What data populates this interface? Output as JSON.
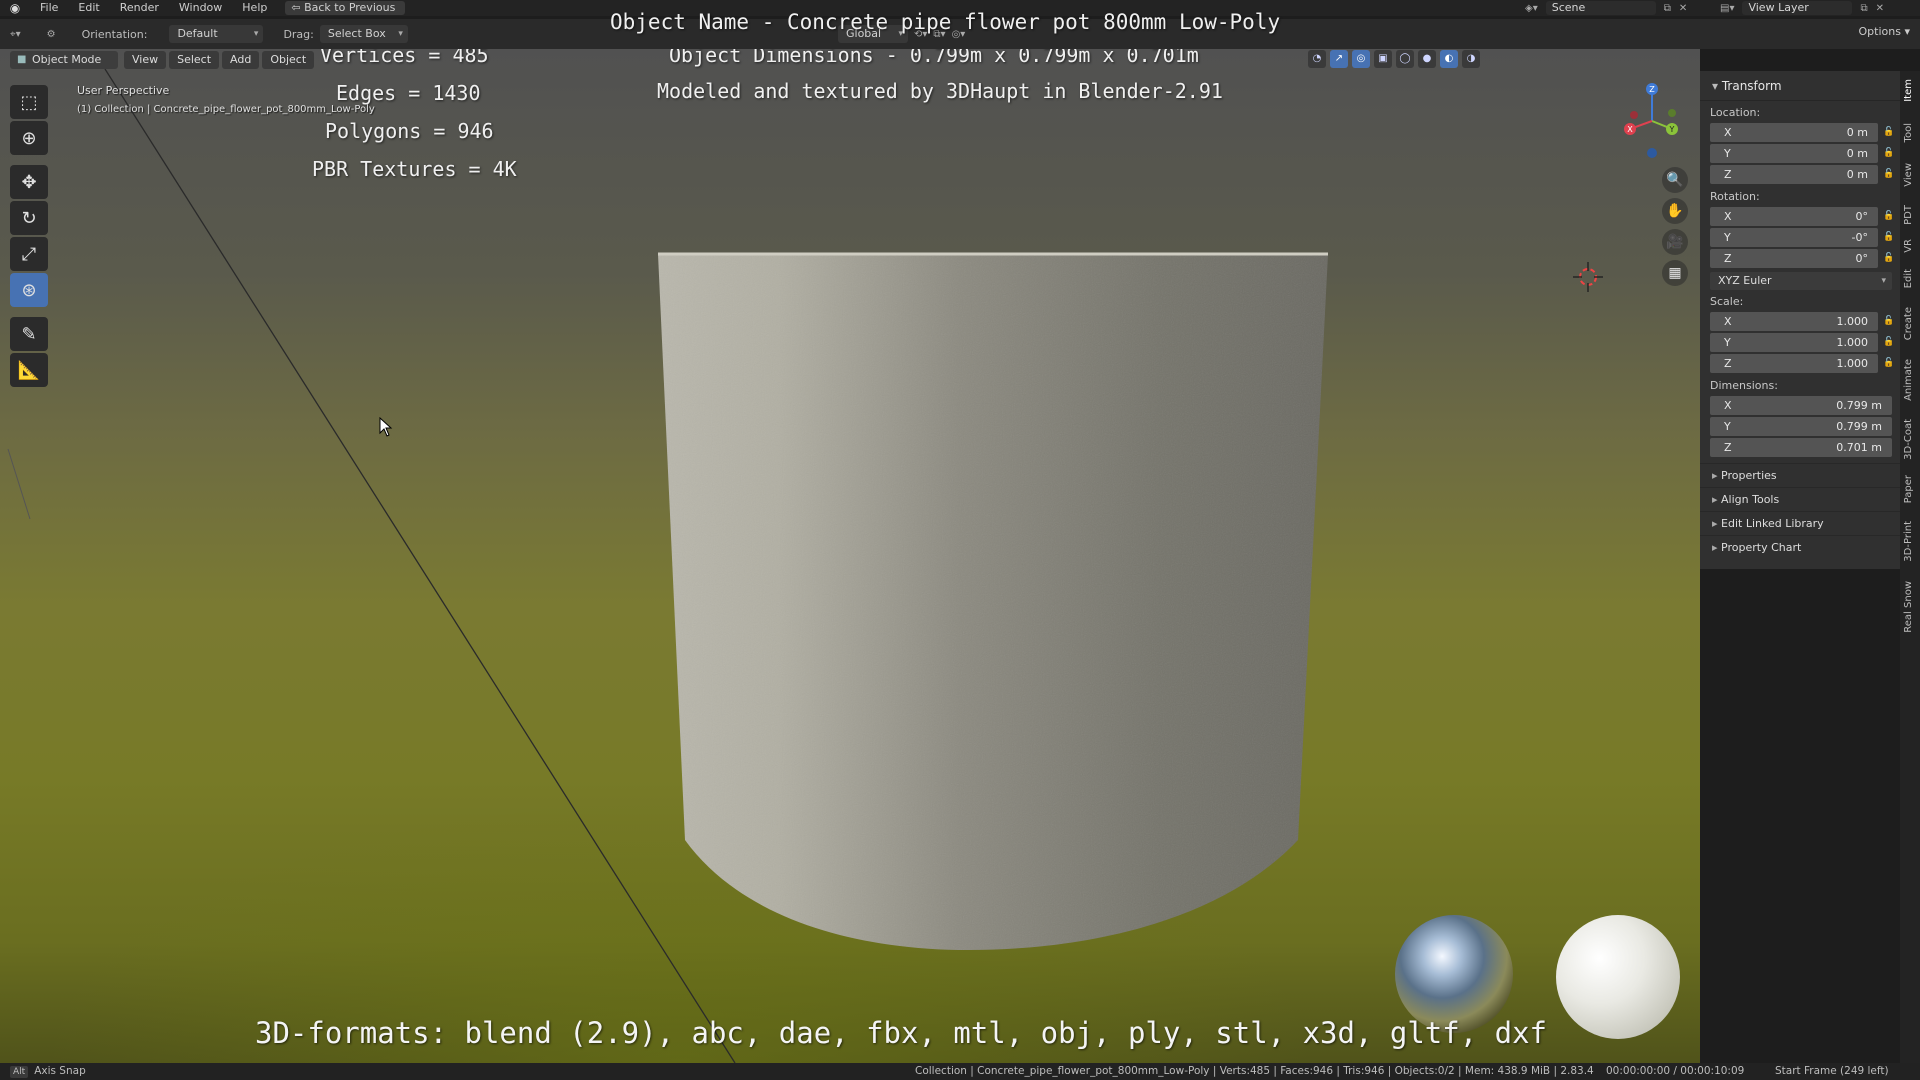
{
  "menubar": {
    "items": [
      "File",
      "Edit",
      "Render",
      "Window",
      "Help"
    ],
    "back_button": "Back to Previous",
    "scene": "Scene",
    "view_layer": "View Layer"
  },
  "header": {
    "orientation_label": "Orientation:",
    "orientation_value": "Default",
    "drag_label": "Drag:",
    "drag_value": "Select Box",
    "transform_orientation": "Global",
    "options": "Options"
  },
  "viewport_header": {
    "mode": "Object Mode",
    "menus": [
      "View",
      "Select",
      "Add",
      "Object"
    ]
  },
  "viewport": {
    "perspective_label": "User Perspective",
    "collection_label": "(1) Collection | Concrete_pipe_flower_pot_800mm_Low-Poly",
    "overlay": {
      "title": "Object Name - Concrete pipe flower pot 800mm Low-Poly",
      "dimensions": "Object Dimensions -  0.799m x 0.799m x 0.701m",
      "credit": "Modeled and textured by 3DHaupt in Blender-2.91",
      "vertices": "Vertices = 485",
      "edges": "Edges = 1430",
      "polygons": "Polygons = 946",
      "textures": "PBR Textures = 4K",
      "formats": "3D-formats: blend (2.9), abc, dae, fbx, mtl, obj, ply, stl, x3d, gltf, dxf"
    },
    "tools": [
      "select-box-icon",
      "cursor-icon",
      "move-icon",
      "rotate-icon",
      "scale-icon",
      "transform-icon",
      "annotate-icon",
      "measure-icon"
    ],
    "gizmo_axes": [
      "X",
      "Y",
      "Z"
    ]
  },
  "npanel": {
    "transform_title": "Transform",
    "location_label": "Location:",
    "location": [
      {
        "axis": "X",
        "value": "0 m"
      },
      {
        "axis": "Y",
        "value": "0 m"
      },
      {
        "axis": "Z",
        "value": "0 m"
      }
    ],
    "rotation_label": "Rotation:",
    "rotation": [
      {
        "axis": "X",
        "value": "0°"
      },
      {
        "axis": "Y",
        "value": "-0°"
      },
      {
        "axis": "Z",
        "value": "0°"
      }
    ],
    "rotation_mode": "XYZ Euler",
    "scale_label": "Scale:",
    "scale": [
      {
        "axis": "X",
        "value": "1.000"
      },
      {
        "axis": "Y",
        "value": "1.000"
      },
      {
        "axis": "Z",
        "value": "1.000"
      }
    ],
    "dimensions_label": "Dimensions:",
    "dimensions": [
      {
        "axis": "X",
        "value": "0.799 m"
      },
      {
        "axis": "Y",
        "value": "0.799 m"
      },
      {
        "axis": "Z",
        "value": "0.701 m"
      }
    ],
    "sections": [
      "Properties",
      "Align Tools",
      "Edit Linked Library",
      "Property Chart"
    ]
  },
  "vertical_tabs": [
    "Item",
    "Tool",
    "View",
    "PDT",
    "VR",
    "Edit",
    "Create",
    "Animate",
    "3D-Coat",
    "Paper",
    "3D-Print",
    "Real Snow"
  ],
  "statusbar": {
    "alt_key": "Alt",
    "left": "Axis Snap",
    "middle": "Collection | Concrete_pipe_flower_pot_800mm_Low-Poly | Verts:485 | Faces:946 | Tris:946 | Objects:0/2 | Mem: 438.9 MiB | 2.83.4",
    "time": "00:00:00:00 / 00:00:10:09",
    "right": "Start Frame (249 left)"
  },
  "colors": {
    "accent": "#4772b3",
    "axis_x": "#e0414f",
    "axis_y": "#8bc43a",
    "axis_z": "#3f7bd8"
  }
}
